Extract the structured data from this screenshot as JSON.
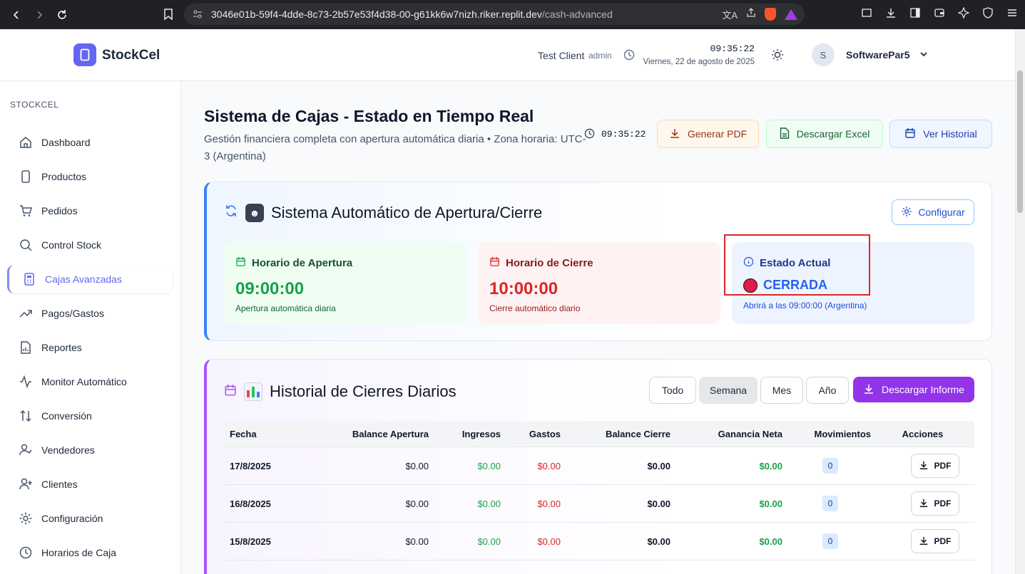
{
  "browser": {
    "url_host": "3046e01b-59f4-4dde-8c73-2b57e53f4d38-00-g61kk6w7nizh.riker.replit.dev",
    "url_path": "/cash-advanced"
  },
  "header": {
    "brand": "StockCel",
    "client": "Test Client",
    "role": "admin",
    "time": "09:35:22",
    "date": "Viernes, 22 de agosto de 2025",
    "avatar_initial": "S",
    "username": "SoftwarePar5"
  },
  "sidebar": {
    "section_title": "STOCKCEL",
    "items": [
      {
        "label": "Dashboard",
        "icon": "home-icon"
      },
      {
        "label": "Productos",
        "icon": "phone-icon"
      },
      {
        "label": "Pedidos",
        "icon": "cart-icon"
      },
      {
        "label": "Control Stock",
        "icon": "search-icon"
      },
      {
        "label": "Cajas Avanzadas",
        "icon": "calculator-icon",
        "active": true
      },
      {
        "label": "Pagos/Gastos",
        "icon": "trending-up-icon"
      },
      {
        "label": "Reportes",
        "icon": "report-icon"
      },
      {
        "label": "Monitor Automático",
        "icon": "activity-icon"
      },
      {
        "label": "Conversión",
        "icon": "arrows-updown-icon"
      },
      {
        "label": "Vendedores",
        "icon": "user-check-icon"
      },
      {
        "label": "Clientes",
        "icon": "user-plus-icon"
      },
      {
        "label": "Configuración",
        "icon": "gear-icon"
      },
      {
        "label": "Horarios de Caja",
        "icon": "clock-icon"
      }
    ]
  },
  "page": {
    "title": "Sistema de Cajas - Estado en Tiempo Real",
    "subtitle": "Gestión financiera completa con apertura automática diaria • Zona horaria: UTC-3 (Argentina)",
    "time": "09:35:22",
    "buttons": {
      "pdf": "Generar PDF",
      "excel": "Descargar Excel",
      "history": "Ver Historial"
    }
  },
  "auto_system": {
    "title": "Sistema Automático de Apertura/Cierre",
    "configure": "Configurar",
    "opening": {
      "title": "Horario de Apertura",
      "time": "09:00:00",
      "note": "Apertura automática diaria"
    },
    "closing": {
      "title": "Horario de Cierre",
      "time": "10:00:00",
      "note": "Cierre automático diario"
    },
    "state": {
      "title": "Estado Actual",
      "value": "CERRADA",
      "note": "Abrirá a las 09:00:00 (Argentina)"
    }
  },
  "history": {
    "title": "Historial de Cierres Diarios",
    "filters": [
      "Todo",
      "Semana",
      "Mes",
      "Año"
    ],
    "active_filter": "Semana",
    "download": "Descargar Informe",
    "columns": [
      "Fecha",
      "Balance Apertura",
      "Ingresos",
      "Gastos",
      "Balance Cierre",
      "Ganancia Neta",
      "Movimientos",
      "Acciones"
    ],
    "action_label": "PDF",
    "rows": [
      {
        "fecha": "17/8/2025",
        "apertura": "$0.00",
        "ingresos": "$0.00",
        "gastos": "$0.00",
        "cierre": "$0.00",
        "ganancia": "$0.00",
        "movimientos": "0"
      },
      {
        "fecha": "16/8/2025",
        "apertura": "$0.00",
        "ingresos": "$0.00",
        "gastos": "$0.00",
        "cierre": "$0.00",
        "ganancia": "$0.00",
        "movimientos": "0"
      },
      {
        "fecha": "15/8/2025",
        "apertura": "$0.00",
        "ingresos": "$0.00",
        "gastos": "$0.00",
        "cierre": "$0.00",
        "ganancia": "$0.00",
        "movimientos": "0"
      }
    ]
  }
}
